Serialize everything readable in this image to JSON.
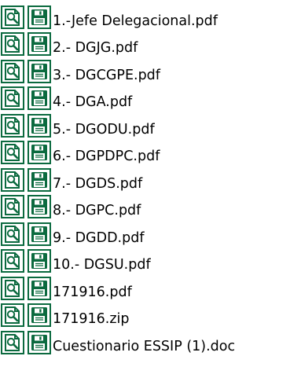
{
  "colors": {
    "icon_border": "#0b6a3f",
    "icon_fill": "#ffffff",
    "text": "#000000",
    "background": "#ffffff"
  },
  "icons": {
    "view": "magnifier-document-icon",
    "download": "floppy-disk-icon"
  },
  "files": [
    {
      "name": "1.-Jefe Delegacional.pdf"
    },
    {
      "name": "2.- DGJG.pdf"
    },
    {
      "name": "3.- DGCGPE.pdf"
    },
    {
      "name": "4.- DGA.pdf"
    },
    {
      "name": "5.- DGODU.pdf"
    },
    {
      "name": "6.- DGPDPC.pdf"
    },
    {
      "name": "7.- DGDS.pdf"
    },
    {
      "name": "8.- DGPC.pdf"
    },
    {
      "name": "9.- DGDD.pdf"
    },
    {
      "name": "10.- DGSU.pdf"
    },
    {
      "name": "171916.pdf"
    },
    {
      "name": "171916.zip"
    },
    {
      "name": "Cuestionario ESSIP (1).doc"
    }
  ]
}
